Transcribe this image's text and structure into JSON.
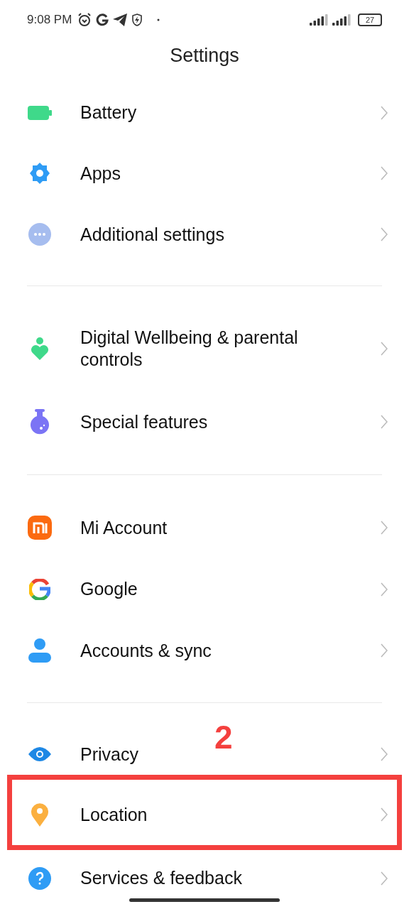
{
  "status_bar": {
    "time": "9:08 PM",
    "battery": "27"
  },
  "title": "Settings",
  "groups": [
    {
      "items": [
        {
          "label": "Battery",
          "kind": "battery",
          "highlighted": false
        },
        {
          "label": "Apps",
          "kind": "gear",
          "highlighted": false
        },
        {
          "label": "Additional settings",
          "kind": "more",
          "highlighted": false
        }
      ]
    },
    {
      "items": [
        {
          "label": "Digital Wellbeing & parental controls",
          "kind": "wellbeing",
          "highlighted": false
        },
        {
          "label": "Special features",
          "kind": "flask",
          "highlighted": false
        }
      ]
    },
    {
      "items": [
        {
          "label": "Mi Account",
          "kind": "mi",
          "highlighted": false
        },
        {
          "label": "Google",
          "kind": "google",
          "highlighted": false
        },
        {
          "label": "Accounts & sync",
          "kind": "person",
          "highlighted": false
        }
      ]
    },
    {
      "items": [
        {
          "label": "Privacy",
          "kind": "eye",
          "highlighted": false
        },
        {
          "label": "Location",
          "kind": "pin",
          "highlighted": true,
          "annotation": "2"
        },
        {
          "label": "Services & feedback",
          "kind": "help",
          "highlighted": false
        }
      ]
    }
  ]
}
